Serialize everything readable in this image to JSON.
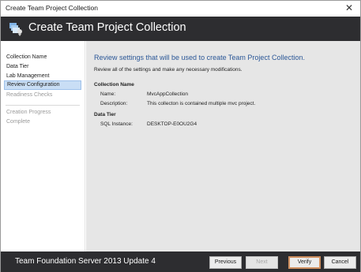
{
  "window": {
    "title": "Create Team Project Collection",
    "close_glyph": "✕"
  },
  "header": {
    "title": "Create Team Project Collection",
    "icon": "team-project-icon"
  },
  "sidebar": {
    "items": [
      {
        "label": "Collection Name",
        "state": "normal"
      },
      {
        "label": "Data Tier",
        "state": "normal"
      },
      {
        "label": "Lab Management",
        "state": "normal"
      },
      {
        "label": "Review Configuration",
        "state": "active"
      },
      {
        "label": "Readiness Checks",
        "state": "disabled"
      },
      {
        "label": "Creation Progress",
        "state": "disabled"
      },
      {
        "label": "Complete",
        "state": "disabled"
      }
    ]
  },
  "main": {
    "heading": "Review settings that will be used to create Team Project Collection.",
    "subheading": "Review all of the settings and make any necessary modifications.",
    "collection": {
      "title": "Collection Name",
      "name_label": "Name:",
      "name_value": "MvcAppCollection",
      "description_label": "Description:",
      "description_value": "This collecton is contained multiple mvc project."
    },
    "data_tier": {
      "title": "Data Tier",
      "sql_label": "SQL Instance:",
      "sql_value": "DESKTOP-E0OU2G4"
    }
  },
  "footer": {
    "product": "Team Foundation Server 2013 Update 4",
    "buttons": {
      "previous": "Previous",
      "next": "Next",
      "verify": "Verify",
      "cancel": "Cancel"
    }
  },
  "colors": {
    "header_bg": "#2d2d30",
    "heading_blue": "#2b5797",
    "active_item_bg": "#c9def5",
    "content_bg": "#e6e6e6",
    "verify_border": "#d09060"
  }
}
